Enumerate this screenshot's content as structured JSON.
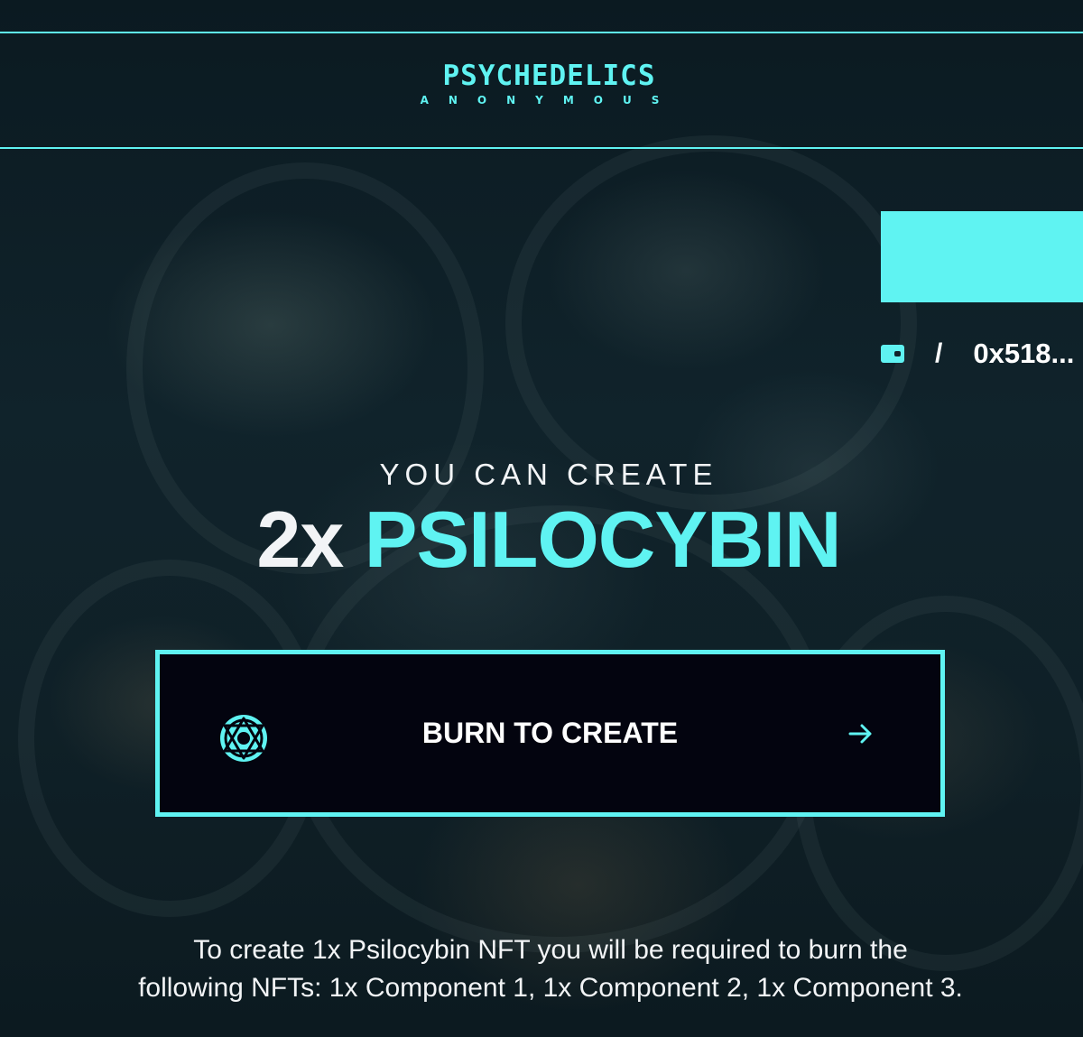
{
  "header": {
    "logo_main": "PSYCHEDELICS",
    "logo_sub": "ANONYMOUS"
  },
  "wallet": {
    "icon": "wallet-icon",
    "separator": "/",
    "address": "0x518..."
  },
  "main": {
    "intro": "YOU CAN CREATE",
    "count": "2x",
    "item": "PSILOCYBIN",
    "burn_button_label": "BURN TO CREATE",
    "burn_button_icon": "psilocybin-emblem-icon",
    "burn_button_arrow": "arrow-right-icon",
    "info_line_1": "To create 1x Psilocybin NFT you will be required to burn the",
    "info_line_2": "following NFTs: 1x Component 1, 1x Component 2, 1x Component 3."
  },
  "colors": {
    "accent": "#5ff3f2",
    "button_bg": "#03040f",
    "text": "#f2f4f6",
    "background": "#10232b"
  }
}
